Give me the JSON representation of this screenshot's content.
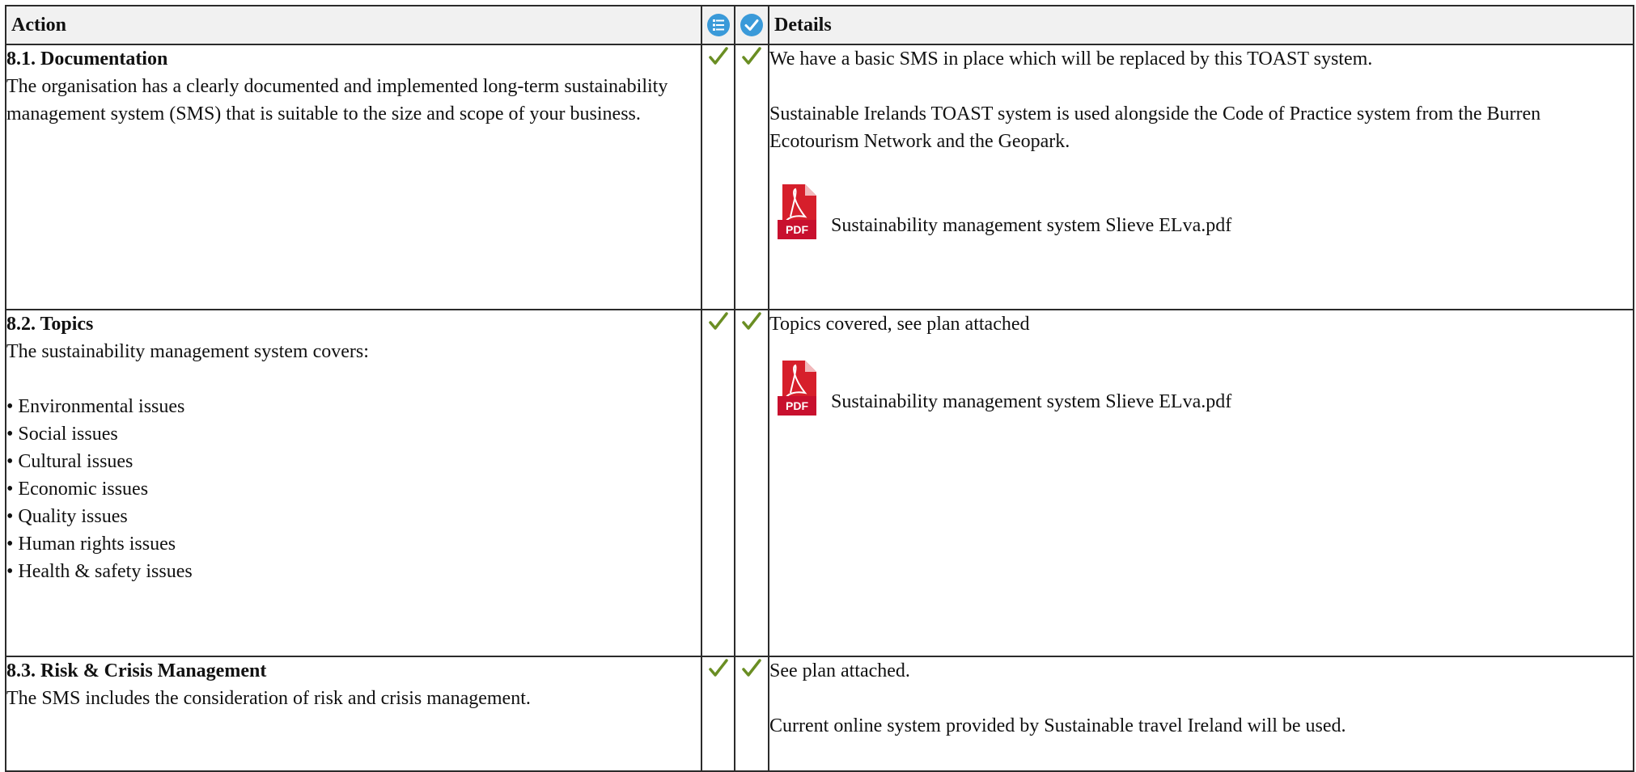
{
  "header": {
    "action_label": "Action",
    "details_label": "Details",
    "status_icon_1": "list-info-icon",
    "status_icon_2": "check-circle-icon"
  },
  "colors": {
    "header_bg": "#f1f1f1",
    "border": "#2b2b2b",
    "check": "#6a8e23",
    "icon_blue": "#3a9ad9",
    "pdf_red": "#c8102e"
  },
  "rows": [
    {
      "title": "8.1. Documentation",
      "description": "The organisation has a clearly documented and implemented long-term sustainability management system (SMS) that is suitable to the size and scope of your business.",
      "status_1": "check-icon",
      "status_2": "check-icon",
      "details": [
        "We have a basic SMS in place which will be replaced by this TOAST system.",
        "Sustainable Irelands TOAST system is used alongside the Code of Practice system from the Burren Ecotourism Network and the Geopark."
      ],
      "attachment": {
        "icon": "pdf-icon",
        "icon_text": "PDF",
        "filename": "Sustainability management system Slieve ELva.pdf"
      }
    },
    {
      "title": "8.2. Topics",
      "description": "The sustainability management system covers:",
      "bullets": [
        "• Environmental issues",
        "• Social issues",
        "• Cultural issues",
        "• Economic issues",
        "• Quality issues",
        "• Human rights issues",
        "• Health & safety issues"
      ],
      "status_1": "check-icon",
      "status_2": "check-icon",
      "details": [
        "Topics covered, see plan attached"
      ],
      "attachment": {
        "icon": "pdf-icon",
        "icon_text": "PDF",
        "filename": "Sustainability management system Slieve ELva.pdf"
      }
    },
    {
      "title": "8.3. Risk & Crisis Management",
      "description": "The SMS includes the consideration of risk and crisis management.",
      "status_1": "check-icon",
      "status_2": "check-icon",
      "details": [
        "See plan attached.",
        "Current online system provided by Sustainable travel Ireland will be used."
      ]
    }
  ]
}
